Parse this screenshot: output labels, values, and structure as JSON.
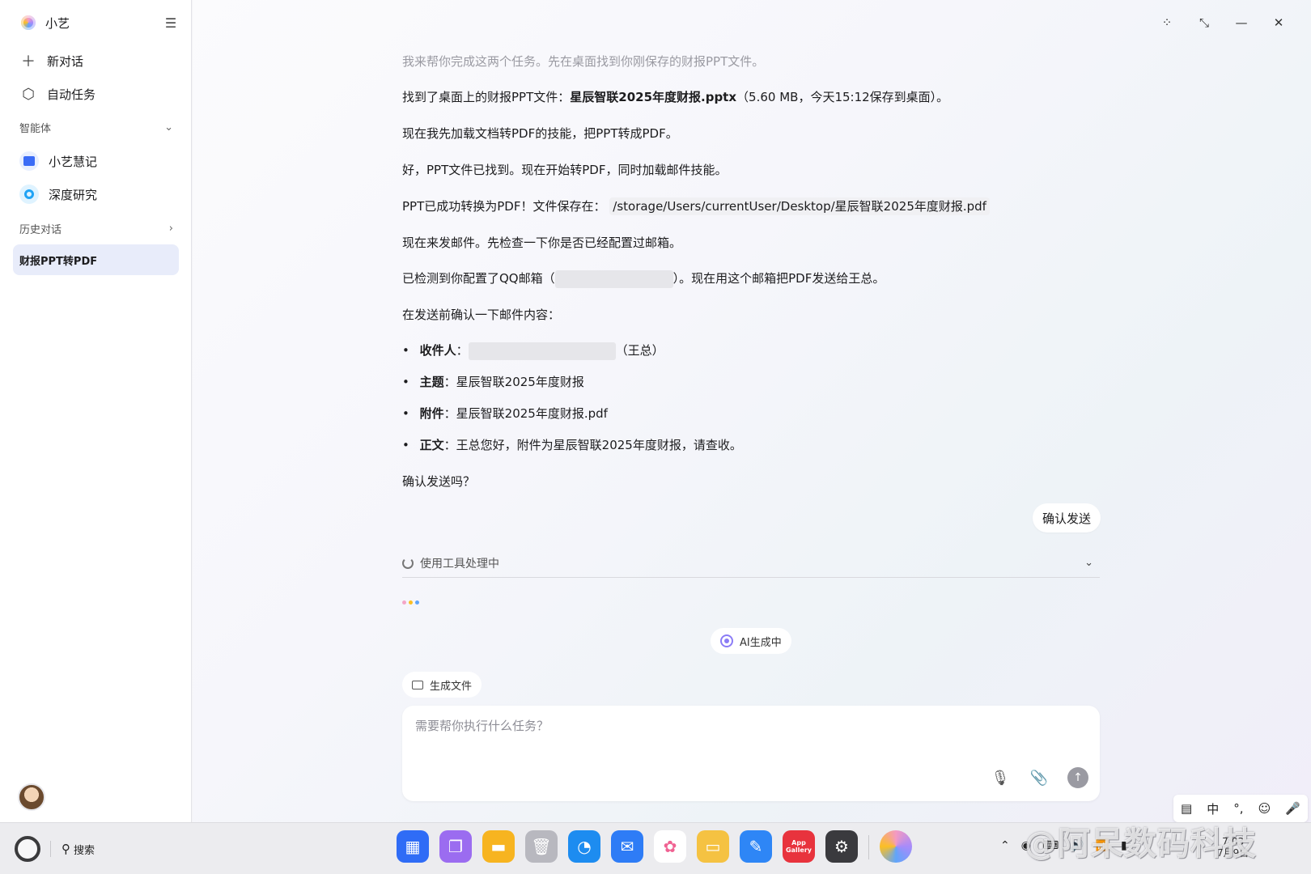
{
  "sidebar": {
    "app_title": "小艺",
    "new_chat": "新对话",
    "auto_task": "自动任务",
    "agents_section": "智能体",
    "agents": [
      {
        "label": "小艺慧记"
      },
      {
        "label": "深度研究"
      }
    ],
    "history_section": "历史对话",
    "history_active": "财报PPT转PDF"
  },
  "chat": {
    "m1": "我来帮你完成这两个任务。先在桌面找到你刚保存的财报PPT文件。",
    "m2_prefix": "找到了桌面上的财报PPT文件：",
    "m2_file": "星辰智联2025年度财报.pptx",
    "m2_suffix": "（5.60 MB，今天15:12保存到桌面）。",
    "m3": "现在我先加载文档转PDF的技能，把PPT转成PDF。",
    "m4": "好，PPT文件已找到。现在开始转PDF，同时加载邮件技能。",
    "m5_prefix": "PPT已成功转换为PDF！文件保存在：",
    "m5_path": "/storage/Users/currentUser/Desktop/星辰智联2025年度财报.pdf",
    "m6": "现在来发邮件。先检查一下你是否已经配置过邮箱。",
    "m7_prefix": "已检测到你配置了QQ邮箱（",
    "m7_suffix": "）。现在用这个邮箱把PDF发送给王总。",
    "m8": "在发送前确认一下邮件内容：",
    "fields": {
      "recipient_label": "收件人",
      "recipient_suffix": "（王总）",
      "subject_label": "主题",
      "subject_value": "星辰智联2025年度财报",
      "attachment_label": "附件",
      "attachment_value": "星辰智联2025年度财报.pdf",
      "body_label": "正文",
      "body_value": "王总您好，附件为星辰智联2025年度财报，请查收。"
    },
    "m9": "确认发送吗？",
    "user_reply": "确认发送",
    "tool_status": "使用工具处理中",
    "ai_generating": "AI生成中",
    "generated_files": "生成文件"
  },
  "composer": {
    "placeholder": "需要帮你执行什么任务？"
  },
  "ime": {
    "mode": "中",
    "punct": "°,"
  },
  "taskbar": {
    "search": "搜索",
    "app_gallery_label": "App Gallery",
    "clock_time": "7:03",
    "clock_date": "7月9日"
  },
  "watermark": "@阿呆数码科技",
  "colors": {
    "active_history_bg": "#e8ecfa",
    "accent_purple": "#8b7cf6"
  }
}
